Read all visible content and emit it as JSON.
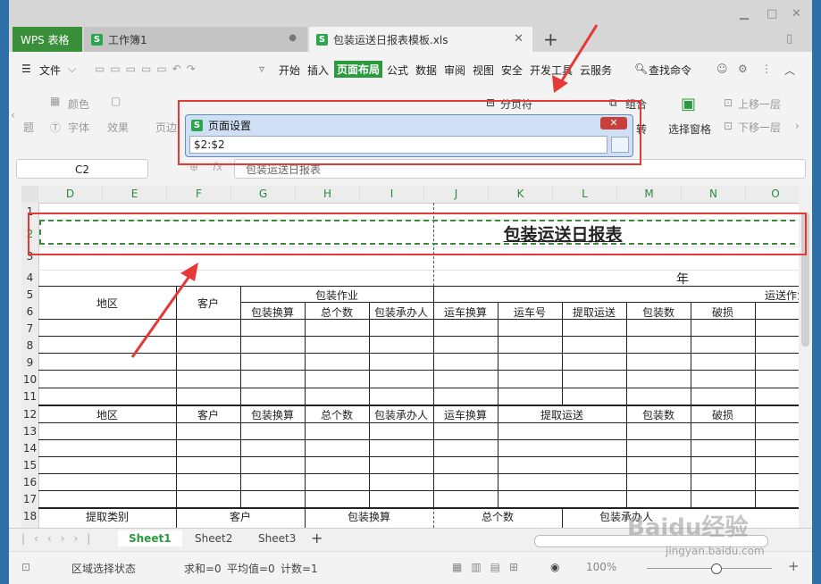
{
  "tabs": {
    "wps": "WPS 表格",
    "workbook1": "工作簿1",
    "active": "包装运送日报表模板.xls"
  },
  "menu": [
    "文件",
    "开始",
    "插入",
    "页面布局",
    "公式",
    "数据",
    "审阅",
    "视图",
    "安全",
    "开发工具",
    "云服务"
  ],
  "menu_active": "页面布局",
  "search_cmd": "查找命令",
  "toolbar": {
    "color": "颜色",
    "font": "字体",
    "effect": "效果",
    "theme": "题",
    "page_break": "分页符",
    "group": "组合",
    "ungroup": "转",
    "select_pane": "选择窗格",
    "move_up": "上移一层",
    "move_down": "下移一层",
    "print_preview": "页边"
  },
  "namebox": "C2",
  "formula": "包装运送日报表",
  "dialog": {
    "title": "页面设置",
    "value": "$2:$2"
  },
  "columns": [
    "D",
    "E",
    "F",
    "G",
    "H",
    "I",
    "J",
    "K",
    "L",
    "M",
    "N",
    "O"
  ],
  "rows": [
    "1",
    "2",
    "3",
    "4",
    "5",
    "6",
    "7",
    "8",
    "9",
    "10",
    "11",
    "12",
    "13",
    "14",
    "15",
    "16",
    "17",
    "18"
  ],
  "sheet": {
    "title": "包装运送日报表",
    "year": "年",
    "r5": {
      "region": "地区",
      "customer": "客户",
      "pack_op": "包装作业",
      "ship_op": "运送作业"
    },
    "r6": {
      "pack_calc": "包装换算",
      "total": "总个数",
      "handler": "包装承办人",
      "ship_calc": "运车换算",
      "truck_no": "运车号",
      "pickup": "提取运送",
      "pack_count": "包装数",
      "damage": "破损"
    },
    "r12": {
      "region": "地区",
      "customer": "客户",
      "pack_calc": "包装换算",
      "total": "总个数",
      "handler": "包装承办人",
      "ship_calc": "运车换算",
      "pickup": "提取运送",
      "pack_count": "包装数",
      "damage": "破损"
    },
    "r18": {
      "pickup_type": "提取类别",
      "customer": "客户",
      "pack_calc": "包装换算",
      "total": "总个数",
      "handler": "包装承办人"
    }
  },
  "sheet_tabs": [
    "Sheet1",
    "Sheet2",
    "Sheet3"
  ],
  "status": {
    "mode": "区域选择状态",
    "sum": "求和=0",
    "avg": "平均值=0",
    "count": "计数=1",
    "zoom": "100%"
  },
  "watermark": {
    "logo": "Baidu经验",
    "url": "jingyan.baidu.com"
  },
  "colors": {
    "accent": "#2b9a3e",
    "annotation": "#e53935"
  }
}
